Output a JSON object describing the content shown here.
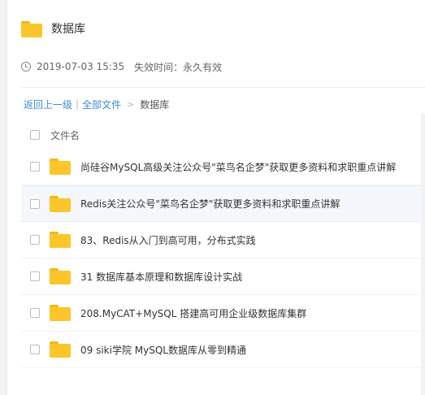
{
  "header": {
    "title": "数据库",
    "icon": "folder-icon",
    "folder_color": "#fcc52a"
  },
  "meta": {
    "icon": "clock-icon",
    "date": "2019-07-03 15:35",
    "expiry": "失效时间：永久有效"
  },
  "breadcrumb": {
    "back": "返回上一级",
    "separator": "|",
    "all_files": "全部文件",
    "arrow": ">",
    "current": "数据库",
    "link_color": "#3b8cdd"
  },
  "list": {
    "column_header": "文件名",
    "items": [
      {
        "name": "尚硅谷MySQL高级关注公众号\"菜鸟名企梦\"获取更多资料和求职重点讲解",
        "icon": "folder-icon"
      },
      {
        "name": "Redis关注公众号\"菜鸟名企梦\"获取更多资料和求职重点讲解",
        "icon": "folder-icon"
      },
      {
        "name": "83、Redis从入门到高可用，分布式实践",
        "icon": "folder-icon"
      },
      {
        "name": "31 数据库基本原理和数据库设计实战",
        "icon": "folder-icon"
      },
      {
        "name": "208.MyCAT+MySQL 搭建高可用企业级数据库集群",
        "icon": "folder-icon"
      },
      {
        "name": "09 siki学院 MySQL数据库从零到精通",
        "icon": "folder-icon"
      }
    ]
  }
}
